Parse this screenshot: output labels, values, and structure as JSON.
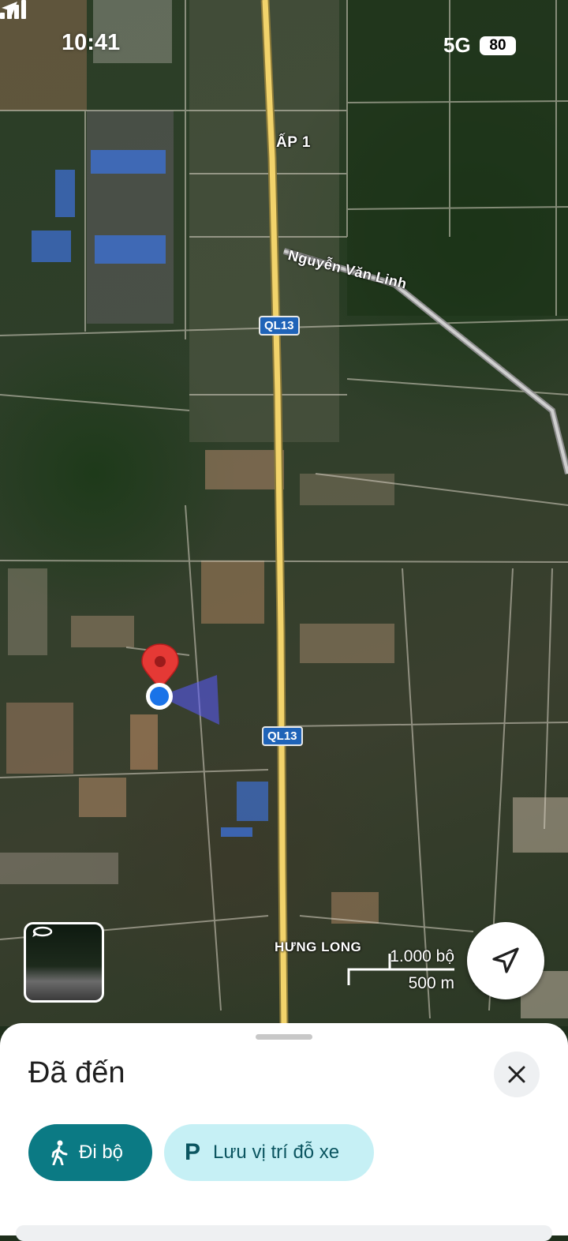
{
  "status_bar": {
    "time": "10:41",
    "network": "5G",
    "battery": "80"
  },
  "map": {
    "labels": {
      "ap1": "ẤP 1",
      "street": "Nguyễn Văn Linh",
      "highway_top": "QL13",
      "highway_bottom": "QL13",
      "hung_long": "HƯNG LONG"
    },
    "scale": {
      "imperial": "1.000 bộ",
      "metric": "500 m"
    },
    "colors": {
      "highway": "#f2d36b",
      "pin": "#e53935",
      "user_location": "#1a73e8"
    }
  },
  "sheet": {
    "title": "Đã đến",
    "walk_label": "Đi bộ",
    "parking_icon": "P",
    "parking_label": "Lưu vị trí đỗ xe"
  }
}
